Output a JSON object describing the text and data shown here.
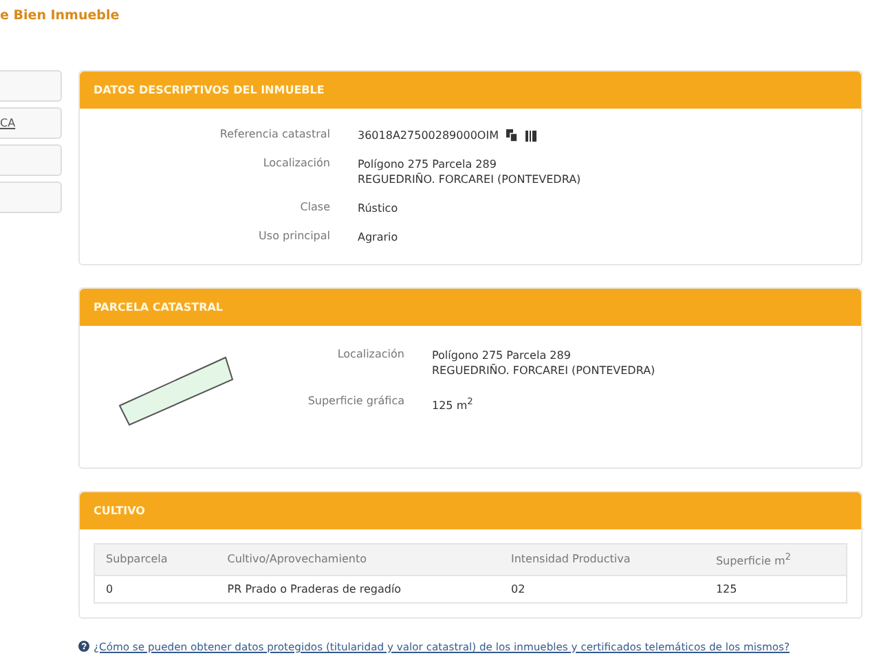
{
  "page_title": "e Bien Inmueble",
  "sidebar": {
    "items": [
      {
        "kind": "blank"
      },
      {
        "kind": "link",
        "label": "CA"
      },
      {
        "kind": "blank"
      },
      {
        "kind": "blank"
      }
    ]
  },
  "descriptive": {
    "title": "DATOS DESCRIPTIVOS DEL INMUEBLE",
    "rows": [
      {
        "label": "Referencia catastral",
        "value": "36018A27500289000OIM",
        "kind": "reference"
      },
      {
        "label": "Localización",
        "value": "Polígono 275 Parcela 289",
        "value2": "REGUEDRIÑO. FORCAREI (PONTEVEDRA)",
        "kind": "text"
      },
      {
        "label": "Clase",
        "value": "Rústico",
        "kind": "text"
      },
      {
        "label": "Uso principal",
        "value": "Agrario",
        "kind": "text"
      }
    ]
  },
  "parcel": {
    "title": "PARCELA CATASTRAL",
    "rows": [
      {
        "label": "Localización",
        "value": "Polígono 275 Parcela 289",
        "value2": "REGUEDRIÑO. FORCAREI (PONTEVEDRA)"
      },
      {
        "label": "Superficie gráfica",
        "value": "125 m$^{2}$"
      }
    ]
  },
  "crops": {
    "title": "CULTIVO",
    "columns": [
      "Subparcela",
      "Cultivo/Aprovechamiento",
      "Intensidad Productiva",
      "Superficie m$^{2}$"
    ],
    "rows": [
      [
        "0",
        "PR Prado o Praderas de regadío",
        "02",
        "125"
      ]
    ]
  },
  "help_link": "¿Cómo se pueden obtener datos protegidos (titularidad y valor catastral) de los inmuebles y certificados telemáticos de los mismos?"
}
